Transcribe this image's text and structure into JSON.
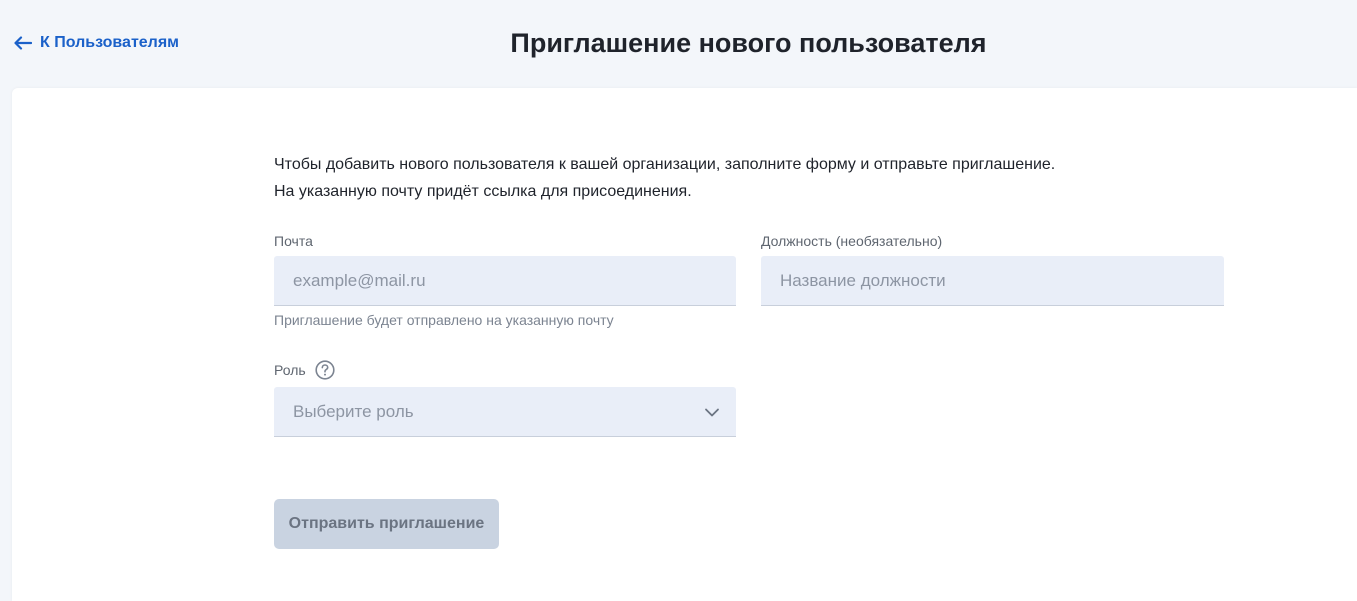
{
  "header": {
    "back_label": "К Пользователям",
    "title": "Приглашение нового пользователя"
  },
  "form": {
    "intro_line1": "Чтобы добавить нового пользователя к вашей организации, заполните форму и отправьте приглашение.",
    "intro_line2": "На указанную почту придёт ссылка для присоединения.",
    "email": {
      "label": "Почта",
      "placeholder": "example@mail.ru",
      "value": "",
      "hint": "Приглашение будет отправлено на указанную почту"
    },
    "position": {
      "label": "Должность (необязательно)",
      "placeholder": "Название должности",
      "value": ""
    },
    "role": {
      "label": "Роль",
      "placeholder": "Выберите роль",
      "help_icon": "question-circle-icon"
    },
    "submit_label": "Отправить приглашение"
  },
  "colors": {
    "accent": "#1b61c9",
    "background": "#f3f6fa",
    "input_bg": "#e9eef8",
    "button_disabled": "#c9d3e1"
  }
}
